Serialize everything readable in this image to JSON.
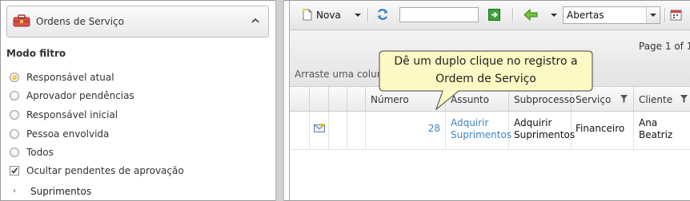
{
  "left_panel": {
    "header_title": "Ordens de Serviço",
    "mode_title": "Modo filtro",
    "options": [
      {
        "label": "Responsável atual",
        "selected": true
      },
      {
        "label": "Aprovador pendências",
        "selected": false
      },
      {
        "label": "Responsável inicial",
        "selected": false
      },
      {
        "label": "Pessoa envolvida",
        "selected": false
      },
      {
        "label": "Todos",
        "selected": false
      }
    ],
    "checkbox_label": "Ocultar pendentes de aprovação",
    "checkbox_checked": true,
    "tree_item": "Suprimentos"
  },
  "toolbar": {
    "new_label": "Nova",
    "search_value": "",
    "status_select": "Abertas"
  },
  "paging_text": "Page 1 of 1",
  "group_hint": "Arraste uma colun",
  "grid": {
    "columns": [
      "Número",
      "Assunto",
      "Subprocesso",
      "Serviço",
      "Cliente"
    ],
    "rows": [
      {
        "numero": "28",
        "assunto": [
          "Adquirir",
          "Suprimentos"
        ],
        "subprocesso": [
          "Adquirir",
          "Suprimentos"
        ],
        "servico": "Financeiro",
        "cliente": [
          "Ana",
          "Beatriz"
        ]
      }
    ]
  },
  "tooltip": {
    "line1": "Dê um duplo clique no registro a",
    "line2": "Ordem de Serviço"
  },
  "colors": {
    "link": "#3b86c6",
    "radio_selected": "#e2a400",
    "tooltip_bg": "#fdf9c4"
  }
}
